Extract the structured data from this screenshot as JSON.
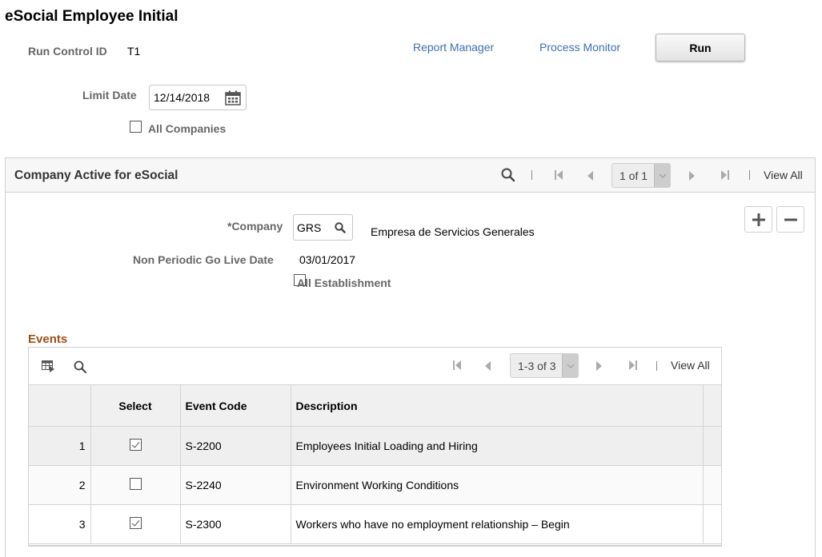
{
  "page": {
    "title": "eSocial Employee Initial",
    "run_control_label": "Run Control ID",
    "run_control_value": "T1",
    "report_manager": "Report Manager",
    "process_monitor": "Process Monitor",
    "run_label": "Run",
    "limit_date_label": "Limit Date",
    "limit_date_value": "12/14/2018",
    "all_companies_label": "All Companies",
    "all_companies_checked": false
  },
  "company_panel": {
    "title": "Company Active for eSocial",
    "pager_text": "1 of 1",
    "view_all": "View All",
    "company_label": "*Company",
    "company_value": "GRS",
    "company_description": "Empresa de Servicios Generales",
    "go_live_label": "Non Periodic Go Live Date",
    "go_live_value": "03/01/2017",
    "all_establishment_label": "All Establishment",
    "all_establishment_checked": false
  },
  "events": {
    "title": "Events",
    "pager_text": "1-3 of 3",
    "view_all": "View All",
    "columns": [
      "",
      "Select",
      "Event Code",
      "Description"
    ],
    "rows": [
      {
        "num": "1",
        "selected": true,
        "code": "S-2200",
        "description": "Employees Initial Loading and Hiring"
      },
      {
        "num": "2",
        "selected": false,
        "code": "S-2240",
        "description": "Environment Working Conditions"
      },
      {
        "num": "3",
        "selected": true,
        "code": "S-2300",
        "description": "Workers who have no employment relationship  – Begin"
      }
    ]
  }
}
